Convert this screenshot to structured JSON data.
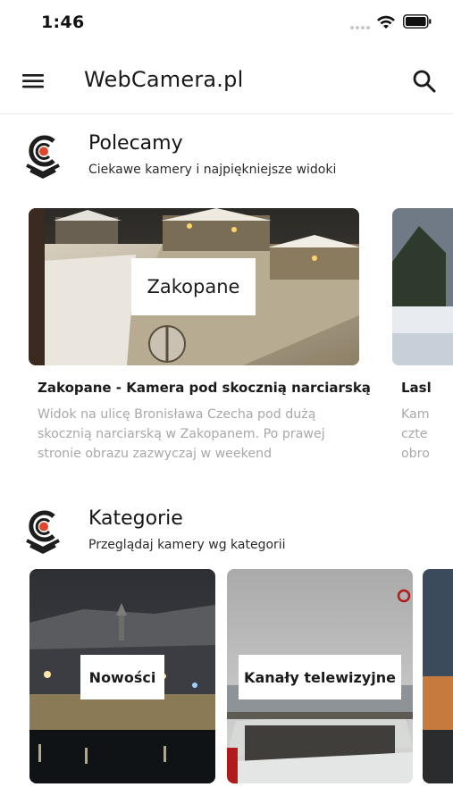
{
  "status": {
    "time": "1:46"
  },
  "header": {
    "title": "WebCamera.pl",
    "menu_icon": "hamburger-menu-icon",
    "search_icon": "search-icon"
  },
  "featured_section": {
    "title": "Polecamy",
    "subtitle": "Ciekawe kamery i najpiękniejsze widoki"
  },
  "featured_cards": [
    {
      "label": "Zakopane",
      "title": "Zakopane - Kamera pod skocznią narciarską",
      "description": "Widok na ulicę Bronisława Czecha pod dużą skocznią narciarską w Zakopanem. Po prawej stronie obrazu zazwyczaj w weekend"
    },
    {
      "label": "",
      "title": "Lasl",
      "description": "Kam czte obro"
    }
  ],
  "categories_section": {
    "title": "Kategorie",
    "subtitle": "Przeglądaj kamery wg kategorii"
  },
  "categories": [
    {
      "label": "Nowości"
    },
    {
      "label": "Kanały telewizyjne"
    }
  ],
  "colors": {
    "brand_red": "#e0462a",
    "brand_dark": "#1d1d1d",
    "muted_text": "#a8a8a8"
  }
}
